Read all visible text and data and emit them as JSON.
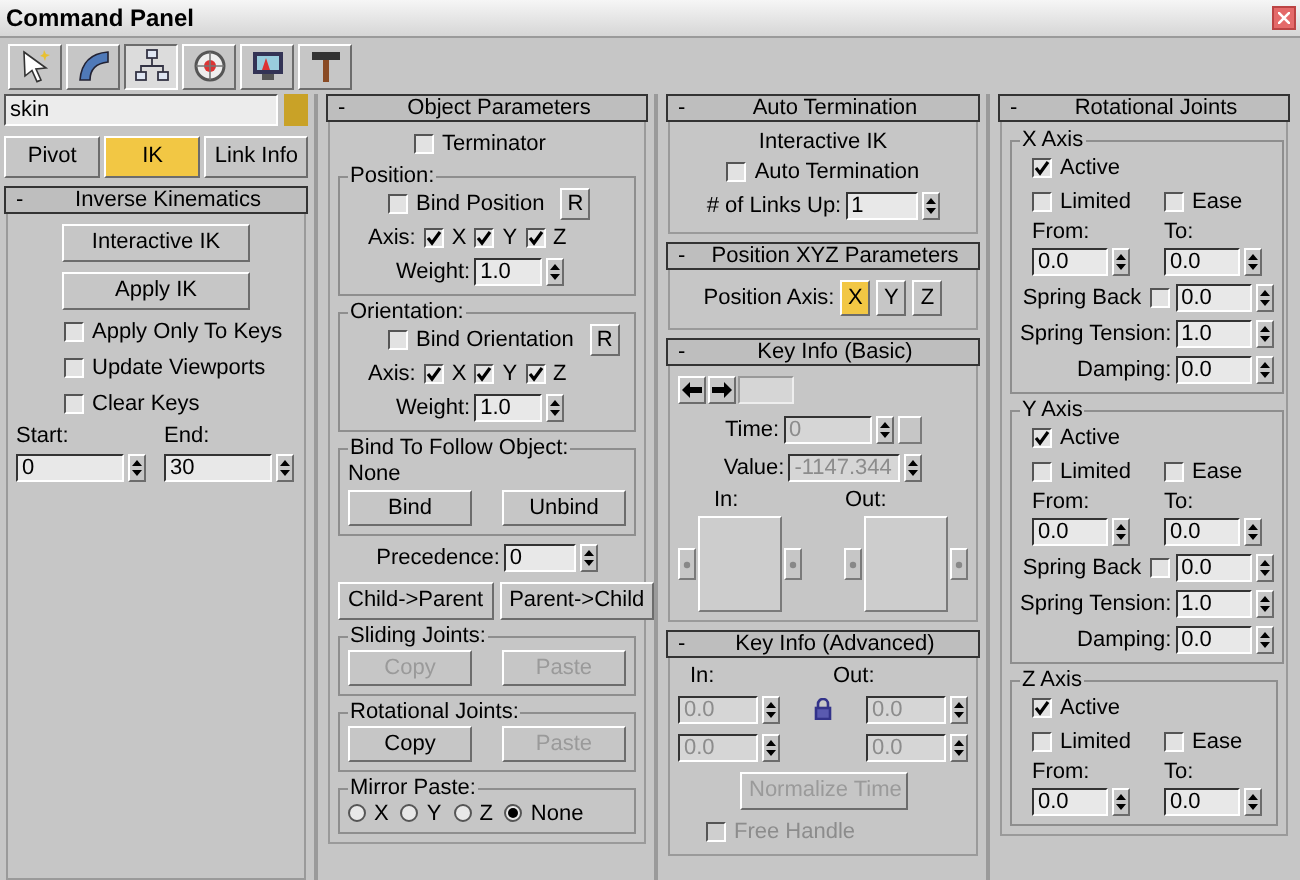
{
  "window": {
    "title": "Command Panel"
  },
  "toolbar_tabs": [
    {
      "kind": "create",
      "selected": false
    },
    {
      "kind": "modify",
      "selected": false
    },
    {
      "kind": "hierarchy",
      "selected": true
    },
    {
      "kind": "motion",
      "selected": false
    },
    {
      "kind": "display",
      "selected": false
    },
    {
      "kind": "utilities",
      "selected": false
    }
  ],
  "object_name": "skin",
  "mode_buttons": [
    {
      "label": "Pivot",
      "selected": false
    },
    {
      "label": "IK",
      "selected": true
    },
    {
      "label": "Link Info",
      "selected": false
    }
  ],
  "inverse_kinematics": {
    "collapse": "-",
    "title": "Inverse Kinematics",
    "buttons": [
      "Interactive IK",
      "Apply IK"
    ],
    "options": [
      {
        "label": "Apply Only To Keys",
        "checked": false
      },
      {
        "label": "Update Viewports",
        "checked": false
      },
      {
        "label": "Clear Keys",
        "checked": false
      }
    ],
    "start_label": "Start:",
    "start": "0",
    "end_label": "End:",
    "end": "30"
  },
  "object_parameters": {
    "collapse": "-",
    "title": "Object Parameters",
    "terminator": {
      "label": "Terminator",
      "checked": false
    },
    "groups": [
      {
        "title": "Position:",
        "bind": {
          "label": "Bind Position",
          "checked": false
        },
        "reset": "R",
        "axis_label": "Axis:",
        "axes": [
          {
            "label": "X",
            "checked": true
          },
          {
            "label": "Y",
            "checked": true
          },
          {
            "label": "Z",
            "checked": true
          }
        ],
        "weight_label": "Weight:",
        "weight": "1.0"
      },
      {
        "title": "Orientation:",
        "bind": {
          "label": "Bind Orientation",
          "checked": false
        },
        "reset": "R",
        "axis_label": "Axis:",
        "axes": [
          {
            "label": "X",
            "checked": true
          },
          {
            "label": "Y",
            "checked": true
          },
          {
            "label": "Z",
            "checked": true
          }
        ],
        "weight_label": "Weight:",
        "weight": "1.0"
      }
    ],
    "follow": {
      "title": "Bind To Follow Object:",
      "object": "None",
      "buttons": [
        {
          "label": "Bind",
          "disabled": false
        },
        {
          "label": "Unbind",
          "disabled": false
        }
      ]
    },
    "precedence_label": "Precedence:",
    "precedence": "0",
    "direction_buttons": [
      "Child->Parent",
      "Parent->Child"
    ],
    "joint_groups": [
      {
        "title": "Sliding Joints:",
        "buttons": [
          {
            "label": "Copy",
            "disabled": true
          },
          {
            "label": "Paste",
            "disabled": true
          }
        ]
      },
      {
        "title": "Rotational Joints:",
        "buttons": [
          {
            "label": "Copy",
            "disabled": false
          },
          {
            "label": "Paste",
            "disabled": true
          }
        ]
      }
    ],
    "mirror_paste": {
      "title": "Mirror Paste:",
      "options": [
        {
          "label": "X",
          "selected": false
        },
        {
          "label": "Y",
          "selected": false
        },
        {
          "label": "Z",
          "selected": false
        },
        {
          "label": "None",
          "selected": true
        }
      ]
    }
  },
  "auto_termination": {
    "collapse": "-",
    "title": "Auto Termination",
    "caption": "Interactive IK",
    "option": {
      "label": "Auto Termination",
      "checked": false
    },
    "links_label": "# of Links Up:",
    "links": "1"
  },
  "position_xyz": {
    "collapse": "-",
    "title": "Position XYZ Parameters",
    "axis_label": "Position Axis:",
    "axes": [
      {
        "label": "X",
        "selected": true
      },
      {
        "label": "Y",
        "selected": false
      },
      {
        "label": "Z",
        "selected": false
      }
    ]
  },
  "key_info_basic": {
    "collapse": "-",
    "title": "Key Info (Basic)",
    "time_label": "Time:",
    "time": "0",
    "value_label": "Value:",
    "value": "-1147.344",
    "in_label": "In:",
    "out_label": "Out:"
  },
  "key_info_advanced": {
    "collapse": "-",
    "title": "Key Info (Advanced)",
    "in_label": "In:",
    "out_label": "Out:",
    "in_values": [
      "0.0",
      "0.0"
    ],
    "out_values": [
      "0.0",
      "0.0"
    ],
    "normalize": {
      "label": "Normalize Time",
      "disabled": true
    },
    "free_handle": {
      "label": "Free Handle",
      "checked": false,
      "disabled": true
    }
  },
  "rotational_joints": {
    "collapse": "-",
    "title": "Rotational Joints",
    "axes": [
      {
        "title": "X Axis",
        "active": {
          "label": "Active",
          "checked": true
        },
        "limited": {
          "label": "Limited",
          "checked": false
        },
        "ease": {
          "label": "Ease",
          "checked": false
        },
        "from_label": "From:",
        "to_label": "To:",
        "from": "0.0",
        "to": "0.0",
        "spring_back": {
          "label": "Spring Back",
          "checked": false,
          "value": "0.0"
        },
        "spring_tension": {
          "label": "Spring Tension:",
          "value": "1.0"
        },
        "damping": {
          "label": "Damping:",
          "value": "0.0"
        }
      },
      {
        "title": "Y Axis",
        "active": {
          "label": "Active",
          "checked": true
        },
        "limited": {
          "label": "Limited",
          "checked": false
        },
        "ease": {
          "label": "Ease",
          "checked": false
        },
        "from_label": "From:",
        "to_label": "To:",
        "from": "0.0",
        "to": "0.0",
        "spring_back": {
          "label": "Spring Back",
          "checked": false,
          "value": "0.0"
        },
        "spring_tension": {
          "label": "Spring Tension:",
          "value": "1.0"
        },
        "damping": {
          "label": "Damping:",
          "value": "0.0"
        }
      },
      {
        "title": "Z Axis",
        "active": {
          "label": "Active",
          "checked": true
        },
        "limited": {
          "label": "Limited",
          "checked": false
        },
        "ease": {
          "label": "Ease",
          "checked": false
        },
        "from_label": "From:",
        "to_label": "To:",
        "from": "0.0",
        "to": "0.0"
      }
    ]
  }
}
